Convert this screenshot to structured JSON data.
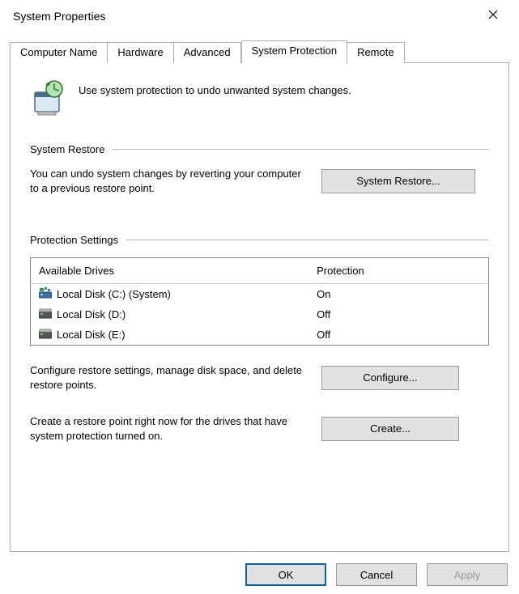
{
  "window": {
    "title": "System Properties"
  },
  "tabs": {
    "computer_name": "Computer Name",
    "hardware": "Hardware",
    "advanced": "Advanced",
    "system_protection": "System Protection",
    "remote": "Remote"
  },
  "intro": "Use system protection to undo unwanted system changes.",
  "groups": {
    "restore_header": "System Restore",
    "restore_desc": "You can undo system changes by reverting your computer to a previous restore point.",
    "restore_button": "System Restore...",
    "settings_header": "Protection Settings",
    "cols": {
      "drives": "Available Drives",
      "protection": "Protection"
    },
    "drives": [
      {
        "name": "Local Disk (C:) (System)",
        "protection": "On",
        "system": true
      },
      {
        "name": "Local Disk (D:)",
        "protection": "Off",
        "system": false
      },
      {
        "name": "Local Disk (E:)",
        "protection": "Off",
        "system": false
      }
    ],
    "configure_desc": "Configure restore settings, manage disk space, and delete restore points.",
    "configure_button": "Configure...",
    "create_desc": "Create a restore point right now for the drives that have system protection turned on.",
    "create_button": "Create..."
  },
  "buttons": {
    "ok": "OK",
    "cancel": "Cancel",
    "apply": "Apply"
  }
}
